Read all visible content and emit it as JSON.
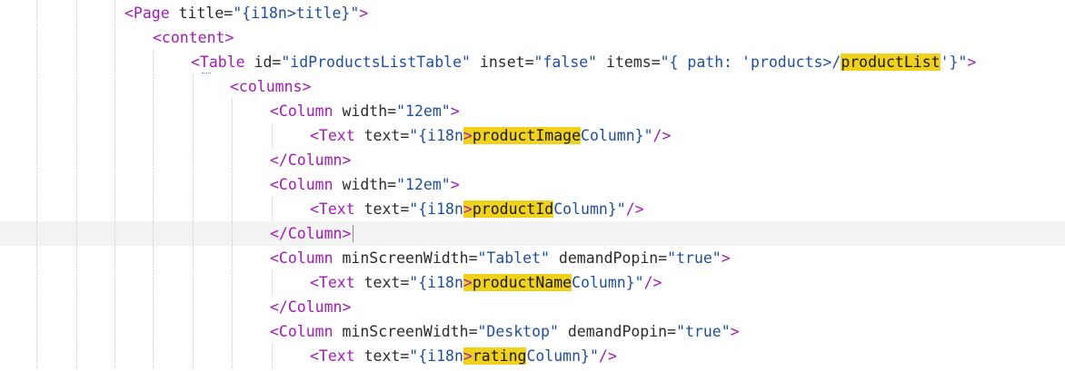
{
  "editor": {
    "lines": [
      {
        "tokens": [
          [
            "tag",
            "<Page"
          ],
          [
            "attr",
            " title"
          ],
          [
            "punct",
            "="
          ],
          [
            "val",
            "\"{i18n>title}\""
          ],
          [
            "tag",
            ">"
          ]
        ]
      },
      {
        "tokens": [
          [
            "tag",
            "<content>"
          ]
        ]
      },
      {
        "tokens": [
          [
            "tag",
            "<Table"
          ],
          [
            "attr",
            " id"
          ],
          [
            "punct",
            "="
          ],
          [
            "val",
            "\"idProductsListTable\""
          ],
          [
            "attr",
            " inset"
          ],
          [
            "punct",
            "="
          ],
          [
            "val",
            "\"false\""
          ],
          [
            "attr",
            " items"
          ],
          [
            "punct",
            "="
          ],
          [
            "val",
            "\"{ path: 'products>/"
          ],
          [
            "hl",
            "productList"
          ],
          [
            "val",
            "'}\""
          ],
          [
            "tag",
            ">"
          ]
        ]
      },
      {
        "tokens": [
          [
            "tag",
            "<columns>"
          ]
        ]
      },
      {
        "tokens": [
          [
            "tag",
            "<Column"
          ],
          [
            "attr",
            " width"
          ],
          [
            "punct",
            "="
          ],
          [
            "val",
            "\"12em\""
          ],
          [
            "tag",
            ">"
          ]
        ]
      },
      {
        "tokens": [
          [
            "tag",
            "<Text"
          ],
          [
            "attr",
            " text"
          ],
          [
            "punct",
            "="
          ],
          [
            "val",
            "\"{i18n"
          ],
          [
            "hl",
            ">productImage"
          ],
          [
            "val",
            "Column}\""
          ],
          [
            "tag",
            "/>"
          ]
        ]
      },
      {
        "tokens": [
          [
            "tag",
            "</Column>"
          ]
        ]
      },
      {
        "tokens": [
          [
            "tag",
            "<Column"
          ],
          [
            "attr",
            " width"
          ],
          [
            "punct",
            "="
          ],
          [
            "val",
            "\"12em\""
          ],
          [
            "tag",
            ">"
          ]
        ]
      },
      {
        "tokens": [
          [
            "tag",
            "<Text"
          ],
          [
            "attr",
            " text"
          ],
          [
            "punct",
            "="
          ],
          [
            "val",
            "\"{i18n"
          ],
          [
            "hl",
            ">productId"
          ],
          [
            "val",
            "Column}\""
          ],
          [
            "tag",
            "/>"
          ]
        ]
      },
      {
        "tokens": [
          [
            "tag",
            "</Column>"
          ]
        ]
      },
      {
        "tokens": [
          [
            "tag",
            "<Column"
          ],
          [
            "attr",
            " minScreenWidth"
          ],
          [
            "punct",
            "="
          ],
          [
            "val",
            "\"Tablet\""
          ],
          [
            "attr",
            " demandPopin"
          ],
          [
            "punct",
            "="
          ],
          [
            "val",
            "\"true\""
          ],
          [
            "tag",
            ">"
          ]
        ]
      },
      {
        "tokens": [
          [
            "tag",
            "<Text"
          ],
          [
            "attr",
            " text"
          ],
          [
            "punct",
            "="
          ],
          [
            "val",
            "\"{i18n"
          ],
          [
            "hl",
            ">productName"
          ],
          [
            "val",
            "Column}\""
          ],
          [
            "tag",
            "/>"
          ]
        ]
      },
      {
        "tokens": [
          [
            "tag",
            "</Column>"
          ]
        ]
      },
      {
        "tokens": [
          [
            "tag",
            "<Column"
          ],
          [
            "attr",
            " minScreenWidth"
          ],
          [
            "punct",
            "="
          ],
          [
            "val",
            "\"Desktop\""
          ],
          [
            "attr",
            " demandPopin"
          ],
          [
            "punct",
            "="
          ],
          [
            "val",
            "\"true\""
          ],
          [
            "tag",
            ">"
          ]
        ]
      },
      {
        "tokens": [
          [
            "tag",
            "<Text"
          ],
          [
            "attr",
            " text"
          ],
          [
            "punct",
            "="
          ],
          [
            "val",
            "\"{i18n"
          ],
          [
            "hl",
            ">rating"
          ],
          [
            "val",
            "Column}\""
          ],
          [
            "tag",
            "/>"
          ]
        ]
      }
    ]
  }
}
